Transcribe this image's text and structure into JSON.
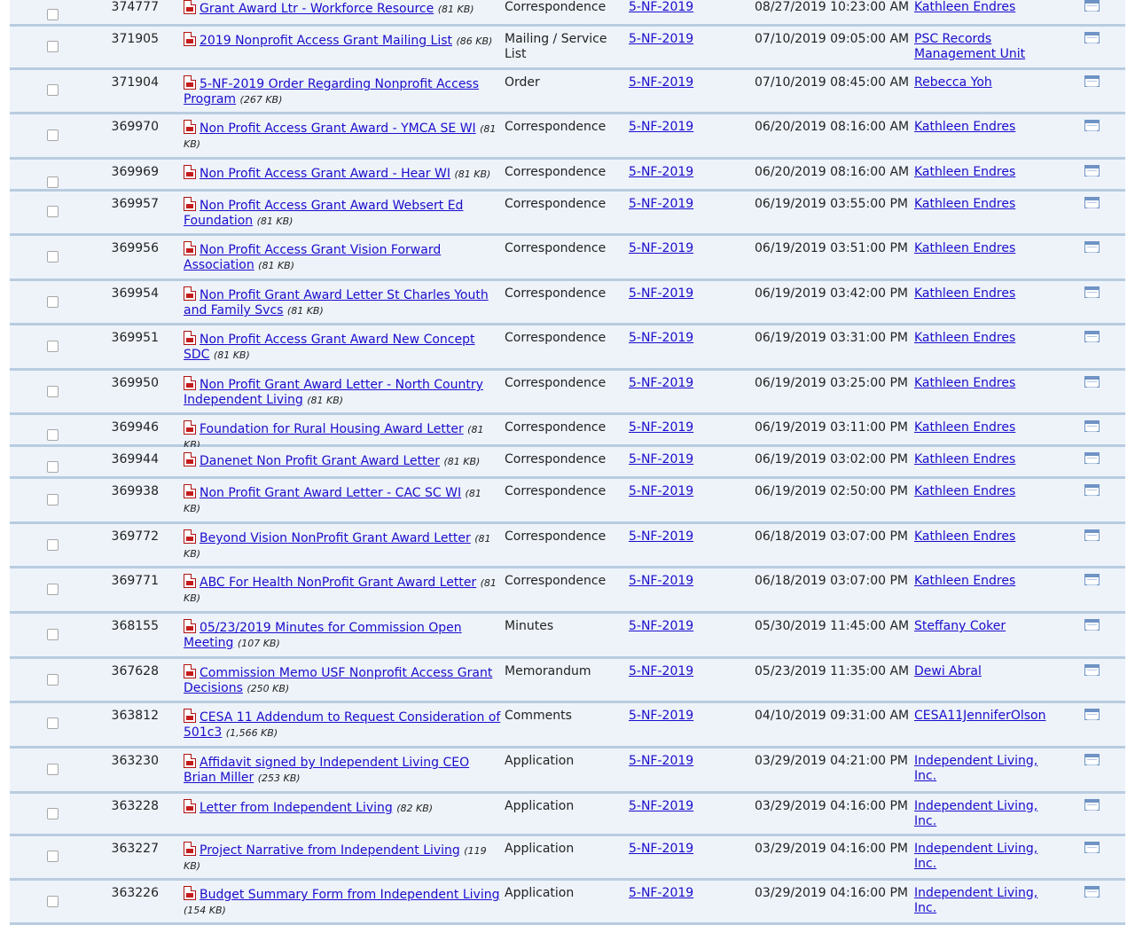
{
  "rows": [
    {
      "id": "374777",
      "title": "Grant Award Ltr - Workforce Resource",
      "size": "(81 KB)",
      "type": "Correspondence",
      "case": "5-NF-2019",
      "date": "08/27/2019 10:23:00 AM",
      "by": "Kathleen Endres"
    },
    {
      "id": "371905",
      "title": "2019 Nonprofit Access Grant Mailing List",
      "size": "(86 KB)",
      "type": "Mailing / Service List",
      "case": "5-NF-2019",
      "date": "07/10/2019 09:05:00 AM",
      "by": "PSC Records Management Unit"
    },
    {
      "id": "371904",
      "title": "5-NF-2019 Order Regarding Nonprofit Access Program",
      "size": "(267 KB)",
      "type": "Order",
      "case": "5-NF-2019",
      "date": "07/10/2019 08:45:00 AM",
      "by": "Rebecca Yoh"
    },
    {
      "id": "369970",
      "title": "Non Profit Access Grant Award - YMCA SE WI",
      "size": "(81 KB)",
      "type": "Correspondence",
      "case": "5-NF-2019",
      "date": "06/20/2019 08:16:00 AM",
      "by": "Kathleen Endres"
    },
    {
      "id": "369969",
      "title": "Non Profit Access Grant Award - Hear WI",
      "size": "(81 KB)",
      "type": "Correspondence",
      "case": "5-NF-2019",
      "date": "06/20/2019 08:16:00 AM",
      "by": "Kathleen Endres"
    },
    {
      "id": "369957",
      "title": "Non Profit Access Grant Award Websert Ed Foundation",
      "size": "(81 KB)",
      "type": "Correspondence",
      "case": "5-NF-2019",
      "date": "06/19/2019 03:55:00 PM",
      "by": "Kathleen Endres"
    },
    {
      "id": "369956",
      "title": "Non Profit Access Grant Vision Forward Association",
      "size": "(81 KB)",
      "type": "Correspondence",
      "case": "5-NF-2019",
      "date": "06/19/2019 03:51:00 PM",
      "by": "Kathleen Endres"
    },
    {
      "id": "369954",
      "title": "Non Profit Grant Award Letter St Charles Youth and Family Svcs",
      "size": "(81 KB)",
      "type": "Correspondence",
      "case": "5-NF-2019",
      "date": "06/19/2019 03:42:00 PM",
      "by": "Kathleen Endres"
    },
    {
      "id": "369951",
      "title": "Non Profit Access Grant Award New Concept SDC",
      "size": "(81 KB)",
      "type": "Correspondence",
      "case": "5-NF-2019",
      "date": "06/19/2019 03:31:00 PM",
      "by": "Kathleen Endres"
    },
    {
      "id": "369950",
      "title": "Non Profit Grant Award Letter - North Country Independent Living",
      "size": "(81 KB)",
      "type": "Correspondence",
      "case": "5-NF-2019",
      "date": "06/19/2019 03:25:00 PM",
      "by": "Kathleen Endres"
    },
    {
      "id": "369946",
      "title": "Foundation for Rural Housing Award Letter",
      "size": "(81 KB)",
      "type": "Correspondence",
      "case": "5-NF-2019",
      "date": "06/19/2019 03:11:00 PM",
      "by": "Kathleen Endres"
    },
    {
      "id": "369944",
      "title": "Danenet Non Profit Grant Award Letter",
      "size": "(81 KB)",
      "type": "Correspondence",
      "case": "5-NF-2019",
      "date": "06/19/2019 03:02:00 PM",
      "by": "Kathleen Endres"
    },
    {
      "id": "369938",
      "title": "Non Profit Grant Award Letter - CAC SC WI",
      "size": "(81 KB)",
      "type": "Correspondence",
      "case": "5-NF-2019",
      "date": "06/19/2019 02:50:00 PM",
      "by": "Kathleen Endres"
    },
    {
      "id": "369772",
      "title": "Beyond Vision NonProfit Grant Award Letter",
      "size": "(81 KB)",
      "type": "Correspondence",
      "case": "5-NF-2019",
      "date": "06/18/2019 03:07:00 PM",
      "by": "Kathleen Endres"
    },
    {
      "id": "369771",
      "title": "ABC For Health NonProfit Grant Award Letter",
      "size": "(81 KB)",
      "type": "Correspondence",
      "case": "5-NF-2019",
      "date": "06/18/2019 03:07:00 PM",
      "by": "Kathleen Endres"
    },
    {
      "id": "368155",
      "title": "05/23/2019 Minutes for Commission Open Meeting",
      "size": "(107 KB)",
      "type": "Minutes",
      "case": "5-NF-2019",
      "date": "05/30/2019 11:45:00 AM",
      "by": "Steffany Coker"
    },
    {
      "id": "367628",
      "title": "Commission Memo USF Nonprofit Access Grant Decisions",
      "size": "(250 KB)",
      "type": "Memorandum",
      "case": "5-NF-2019",
      "date": "05/23/2019 11:35:00 AM",
      "by": "Dewi Abral"
    },
    {
      "id": "363812",
      "title": "CESA 11 Addendum to Request Consideration of 501c3",
      "size": "(1,566 KB)",
      "type": "Comments",
      "case": "5-NF-2019",
      "date": "04/10/2019 09:31:00 AM",
      "by": "CESA11JenniferOlson"
    },
    {
      "id": "363230",
      "title": "Affidavit signed by Independent Living CEO Brian Miller",
      "size": "(253 KB)",
      "type": "Application",
      "case": "5-NF-2019",
      "date": "03/29/2019 04:21:00 PM",
      "by": "Independent Living, Inc."
    },
    {
      "id": "363228",
      "title": "Letter from Independent Living",
      "size": "(82 KB)",
      "type": "Application",
      "case": "5-NF-2019",
      "date": "03/29/2019 04:16:00 PM",
      "by": "Independent Living, Inc."
    },
    {
      "id": "363227",
      "title": "Project Narrative from Independent Living",
      "size": "(119 KB)",
      "type": "Application",
      "case": "5-NF-2019",
      "date": "03/29/2019 04:16:00 PM",
      "by": "Independent Living, Inc."
    },
    {
      "id": "363226",
      "title": "Budget Summary Form from Independent Living",
      "size": "(154 KB)",
      "type": "Application",
      "case": "5-NF-2019",
      "date": "03/29/2019 04:16:00 PM",
      "by": "Independent Living, Inc."
    }
  ]
}
